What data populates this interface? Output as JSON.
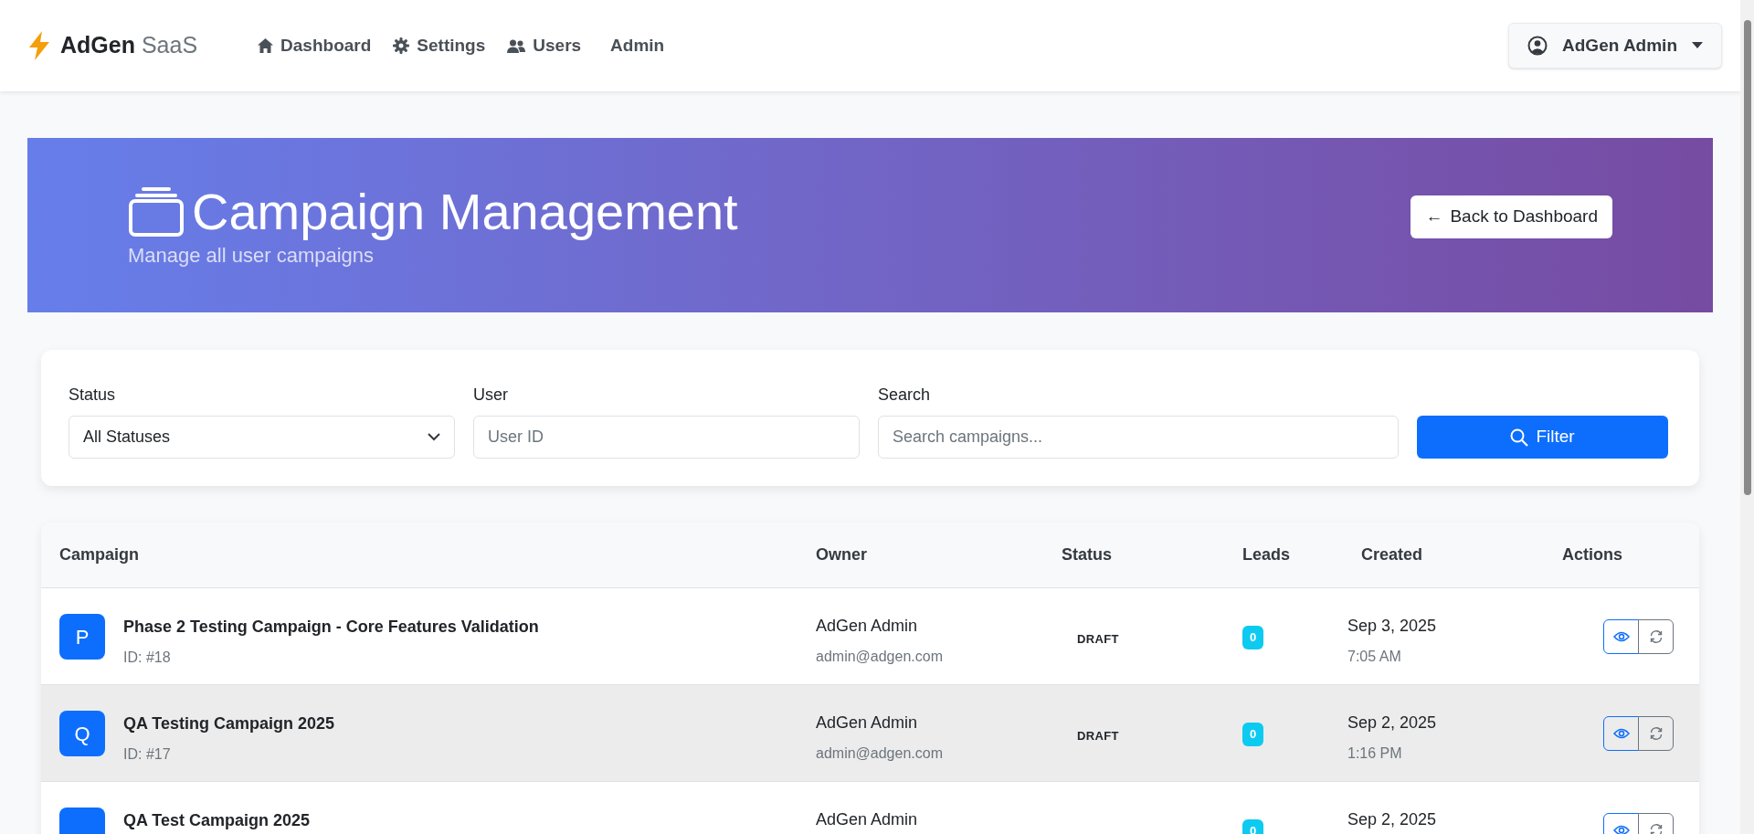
{
  "navbar": {
    "brand": {
      "bold": "AdGen",
      "light": "SaaS"
    },
    "links": [
      {
        "label": "Dashboard"
      },
      {
        "label": "Settings"
      },
      {
        "label": "Users"
      },
      {
        "label": "Admin"
      }
    ],
    "user_menu": {
      "label": "AdGen Admin"
    }
  },
  "header": {
    "title": "Campaign Management",
    "subtitle": "Manage all user campaigns",
    "back_button": {
      "arrow": "←",
      "label": "Back to Dashboard"
    }
  },
  "filters": {
    "status": {
      "label": "Status",
      "value": "All Statuses"
    },
    "user": {
      "label": "User",
      "placeholder": "User ID"
    },
    "search": {
      "label": "Search",
      "placeholder": "Search campaigns..."
    },
    "button": "Filter"
  },
  "table": {
    "columns": [
      "Campaign",
      "Owner",
      "Status",
      "Leads",
      "Created",
      "Actions"
    ],
    "rows": [
      {
        "initial": "P",
        "name": "Phase 2 Testing Campaign - Core Features Validation",
        "id": "ID: #18",
        "owner": "AdGen Admin",
        "email": "admin@adgen.com",
        "status": "DRAFT",
        "leads": "0",
        "date": "Sep 3, 2025",
        "time": "7:05 AM",
        "highlighted": false
      },
      {
        "initial": "Q",
        "name": "QA Testing Campaign 2025",
        "id": "ID: #17",
        "owner": "AdGen Admin",
        "email": "admin@adgen.com",
        "status": "DRAFT",
        "leads": "0",
        "date": "Sep 2, 2025",
        "time": "1:16 PM",
        "highlighted": true
      },
      {
        "name": "QA Test Campaign 2025",
        "owner": "AdGen Admin",
        "leads": "0",
        "date": "Sep 2, 2025",
        "highlighted": false
      }
    ]
  }
}
